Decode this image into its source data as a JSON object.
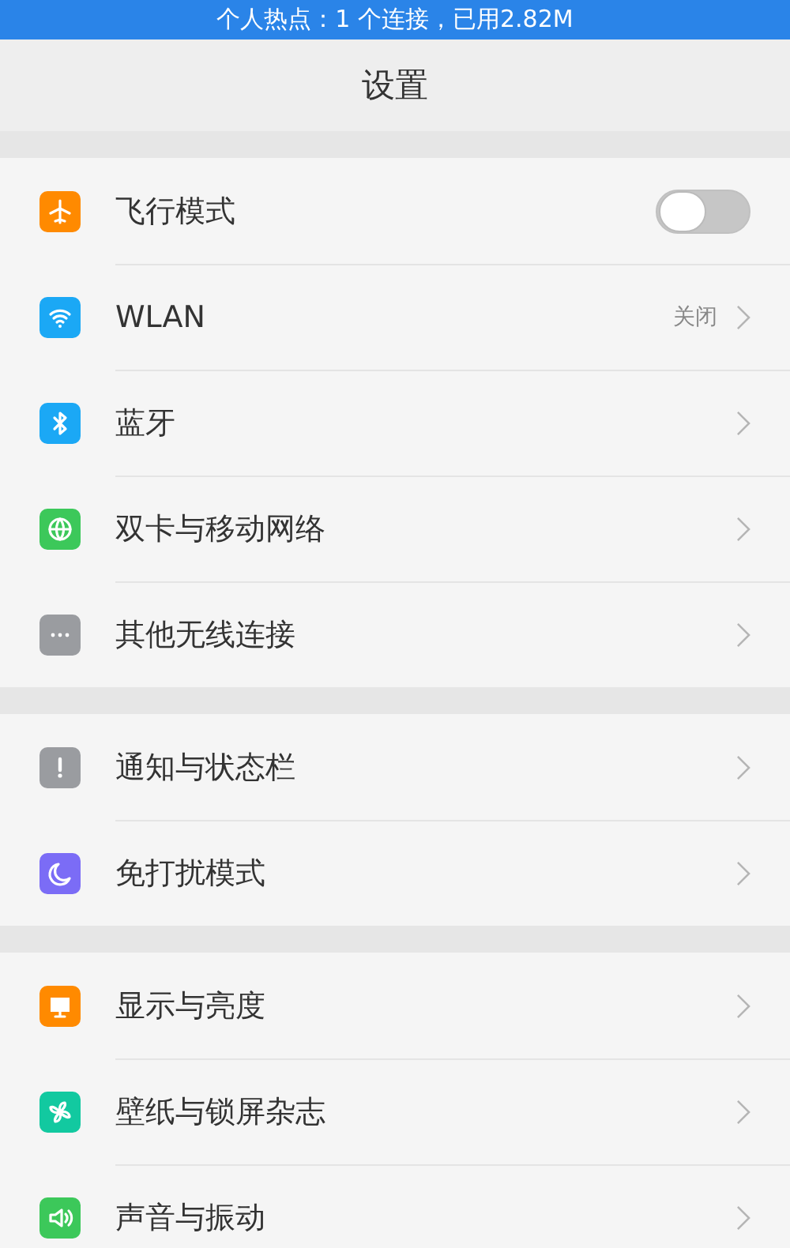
{
  "status_bar": {
    "text": "个人热点：1 个连接，已用2.82M"
  },
  "header": {
    "title": "设置"
  },
  "sections": [
    {
      "items": [
        {
          "kind": "toggle",
          "label": "飞行模式",
          "color": "#ff8a00",
          "on": false
        },
        {
          "kind": "link",
          "label": "WLAN",
          "color": "#1ba8f5",
          "value": "关闭"
        },
        {
          "kind": "link",
          "label": "蓝牙",
          "color": "#1ba8f5"
        },
        {
          "kind": "link",
          "label": "双卡与移动网络",
          "color": "#3cc85a"
        },
        {
          "kind": "link",
          "label": "其他无线连接",
          "color": "#9a9ca0"
        }
      ]
    },
    {
      "items": [
        {
          "kind": "link",
          "label": "通知与状态栏",
          "color": "#9a9ca0"
        },
        {
          "kind": "link",
          "label": "免打扰模式",
          "color": "#7b6cf6"
        }
      ]
    },
    {
      "items": [
        {
          "kind": "link",
          "label": "显示与亮度",
          "color": "#ff8a00"
        },
        {
          "kind": "link",
          "label": "壁纸与锁屏杂志",
          "color": "#12c9a0"
        },
        {
          "kind": "link",
          "label": "声音与振动",
          "color": "#3cc85a"
        }
      ]
    }
  ]
}
